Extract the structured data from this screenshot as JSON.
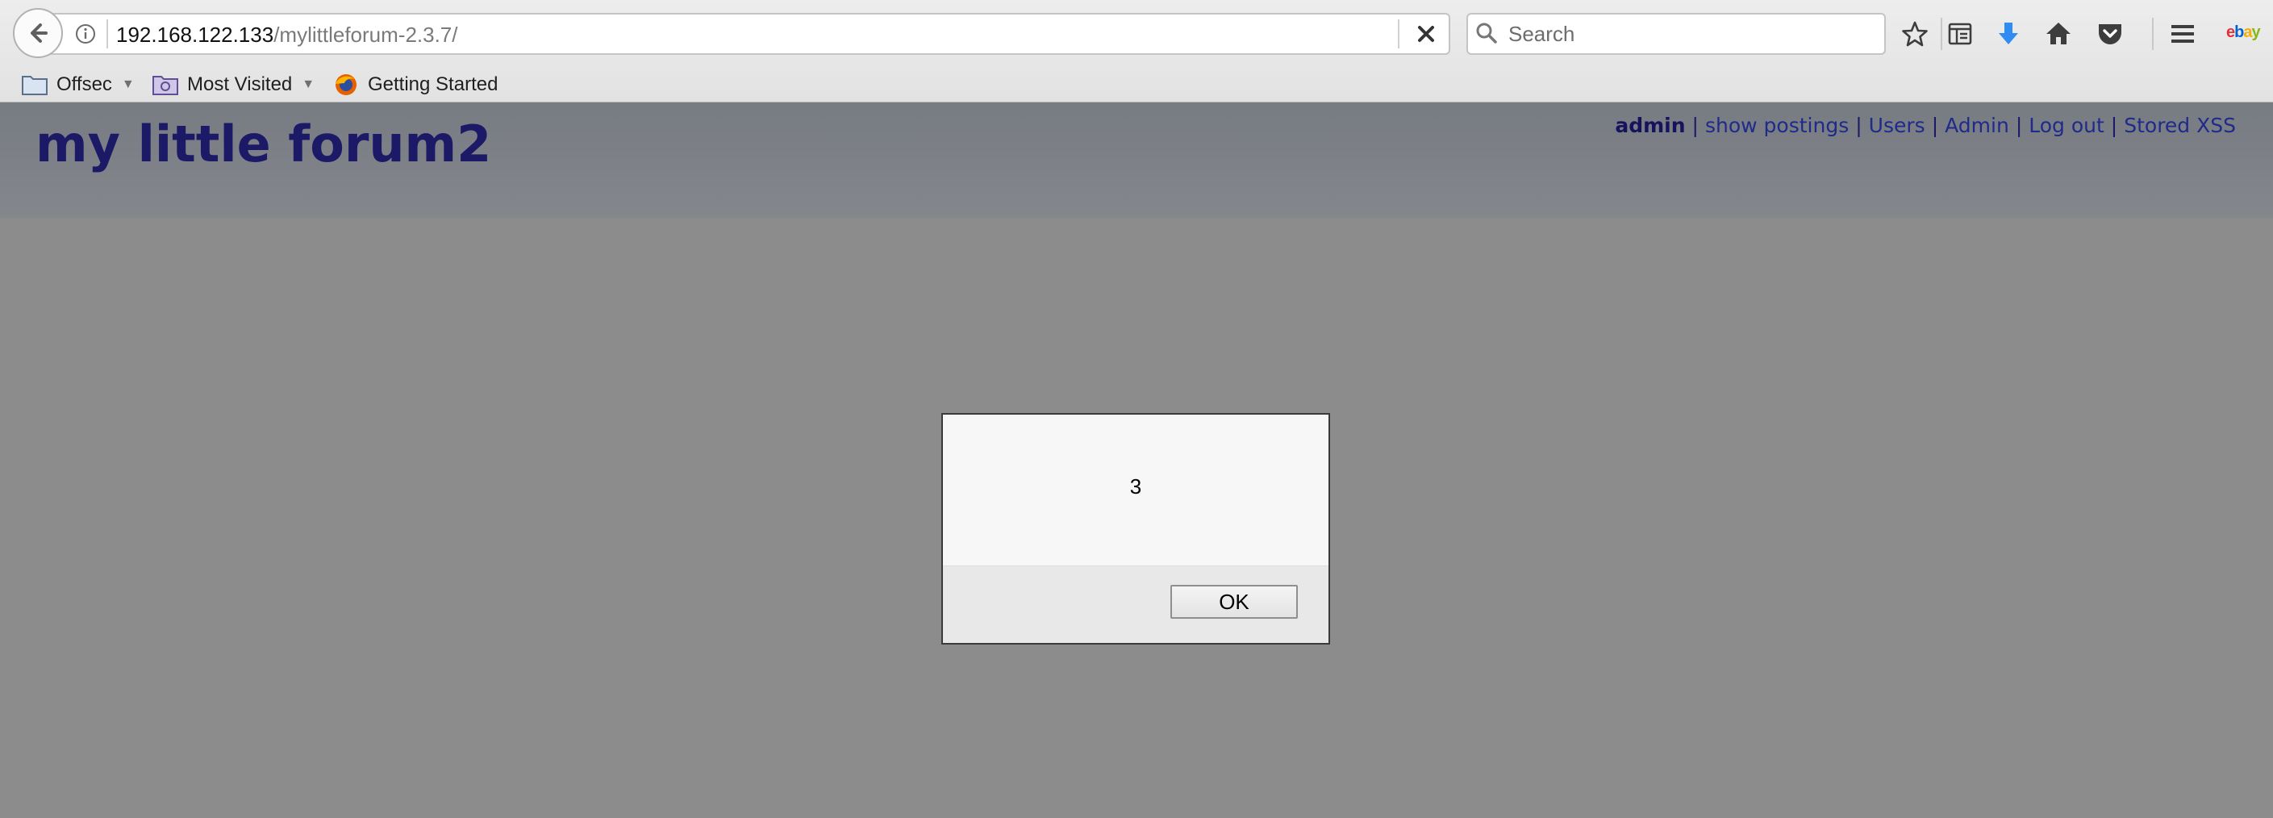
{
  "browser": {
    "url_host": "192.168.122.133",
    "url_path": "/mylittleforum-2.3.7/",
    "search_placeholder": "Search",
    "bookmarks": [
      {
        "label": "Offsec",
        "icon": "folder-icon",
        "has_dropdown": true
      },
      {
        "label": "Most Visited",
        "icon": "smart-folder-icon",
        "has_dropdown": true
      },
      {
        "label": "Getting Started",
        "icon": "firefox-icon",
        "has_dropdown": false
      }
    ],
    "toolbar_icons": [
      "bookmark-star-icon",
      "reading-list-icon",
      "download-icon",
      "home-icon",
      "pocket-icon",
      "menu-icon",
      "ebay-icon"
    ],
    "ebay_letters": [
      "e",
      "b",
      "a",
      "y"
    ],
    "colors": {
      "download_arrow": "#2f8cf3",
      "pocket": "#ef4056"
    }
  },
  "page": {
    "title": "my little forum2",
    "user_menu": {
      "username": "admin",
      "separator": "|",
      "links": [
        "show postings",
        "Users",
        "Admin",
        "Log out",
        "Stored XSS"
      ]
    },
    "colors": {
      "title": "#1c1a66",
      "header_bg": "#777b82",
      "overlay_bg": "#8c8c8c"
    }
  },
  "alert": {
    "message": "3",
    "ok_label": "OK"
  }
}
